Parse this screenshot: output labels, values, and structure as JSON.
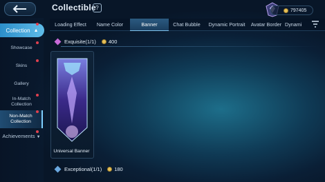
{
  "header": {
    "title": "Collectible",
    "help": "?",
    "currency_value": "797405"
  },
  "tabs": [
    {
      "label": "Loading Effect",
      "active": false
    },
    {
      "label": "Name Color",
      "active": false
    },
    {
      "label": "Banner",
      "active": true
    },
    {
      "label": "Chat Bubble",
      "active": false
    },
    {
      "label": "Dynamic Portrait",
      "active": false
    },
    {
      "label": "Avatar Border",
      "active": false
    },
    {
      "label": "Dynami",
      "active": false
    }
  ],
  "sidebar": {
    "collection_label": "Collection",
    "items": [
      {
        "label": "Showcase"
      },
      {
        "label": "Skins"
      },
      {
        "label": "Gallery"
      },
      {
        "label": "In-Match Collection"
      },
      {
        "label": "Non-Match Collection",
        "selected": true
      }
    ],
    "achievements_label": "Achievements"
  },
  "sections": [
    {
      "label": "Exquisite(1/1)",
      "points": "400",
      "color": "#c86ad8"
    },
    {
      "label": "Exceptional(1/1)",
      "points": "180",
      "color": "#6aa8e0"
    }
  ],
  "card": {
    "label": "Universal Banner"
  },
  "colors": {
    "accent": "#3aa6dd",
    "gold": "#e6c15a",
    "badge": "#e0404f"
  }
}
